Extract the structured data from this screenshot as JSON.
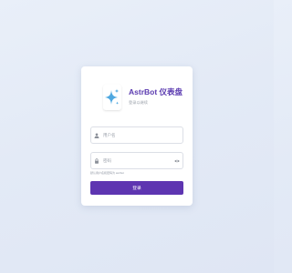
{
  "login": {
    "brand_title": "AstrBot 仪表盘",
    "brand_subtitle": "登录以继续",
    "username_placeholder": "用户名",
    "password_placeholder": "密码",
    "hint": "默认用户名和密码为 astrbot",
    "login_label": "登录"
  },
  "icons": {
    "logo": "sparkles-icon",
    "username": "user-icon",
    "password": "lock-icon",
    "toggle_password": "eye-icon"
  },
  "colors": {
    "accent": "#5e35b1",
    "brand_text": "#5b3bb0",
    "logo_star": "#4fa8e0"
  }
}
